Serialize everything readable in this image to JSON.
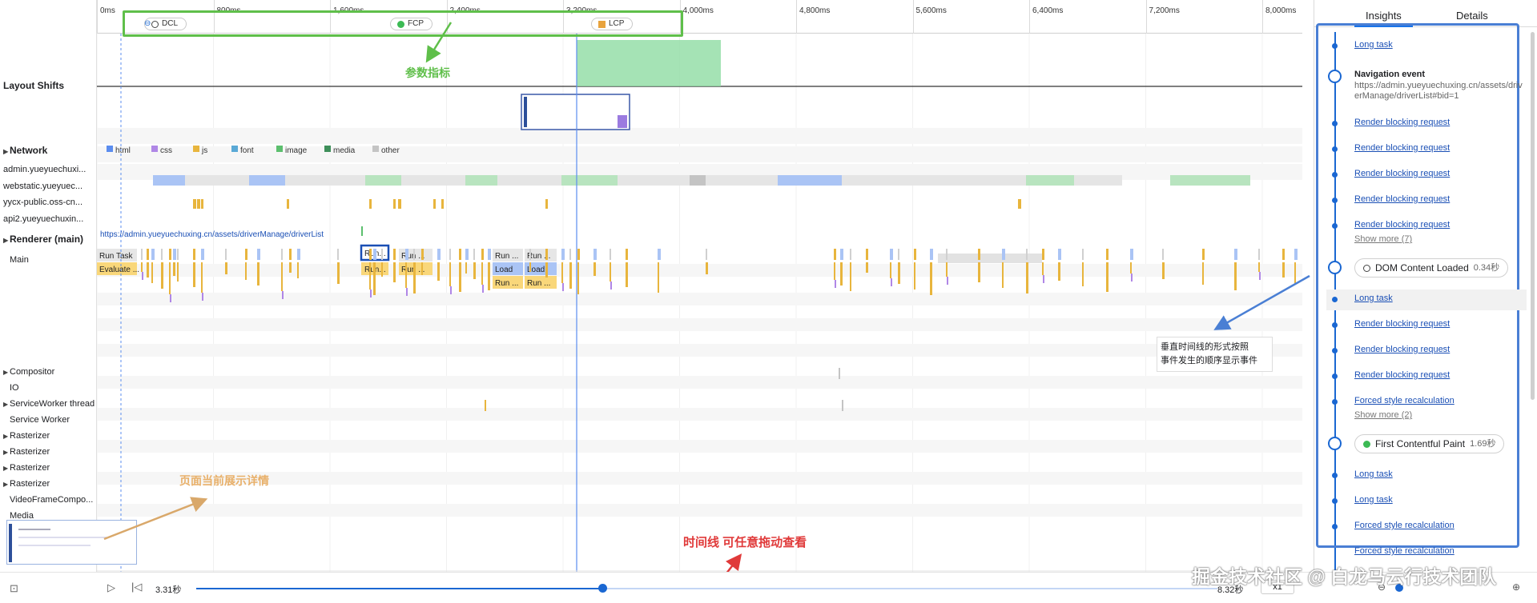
{
  "ruler": {
    "ticks": [
      "0ms",
      "800ms",
      "1,600ms",
      "2,400ms",
      "3,200ms",
      "4,000ms",
      "4,800ms",
      "5,600ms",
      "6,400ms",
      "7,200ms",
      "8,000ms"
    ]
  },
  "markers": {
    "dcl": {
      "label": "DCL",
      "color": "#ffffff"
    },
    "fcp": {
      "label": "FCP",
      "color": "#3cba54"
    },
    "lcp": {
      "label": "LCP",
      "color": "#e8a33d"
    }
  },
  "tracks": {
    "layout_shifts": "Layout Shifts",
    "network": "Network",
    "network_rows": [
      "admin.yueyuechuxi...",
      "webstatic.yueyuec...",
      "yycx-public.oss-cn...",
      "api2.yueyuechuxin..."
    ],
    "renderer": "Renderer (main)",
    "renderer_url": "https://admin.yueyuechuxing.cn/assets/driverManage/driverList",
    "main": "Main",
    "compositor": "Compositor",
    "io": "IO",
    "serviceworker_thread": "ServiceWorker thread",
    "service_worker": "Service Worker",
    "rasterizers": [
      "Rasterizer",
      "Rasterizer",
      "Rasterizer",
      "Rasterizer"
    ],
    "video_frame": "VideoFrameCompo...",
    "media": "Media"
  },
  "legend": [
    {
      "label": "html",
      "color": "#5b8def"
    },
    {
      "label": "css",
      "color": "#b087e6"
    },
    {
      "label": "js",
      "color": "#e8b53d"
    },
    {
      "label": "font",
      "color": "#5aa9d6"
    },
    {
      "label": "image",
      "color": "#5cbf6e"
    },
    {
      "label": "media",
      "color": "#3e8f5a"
    },
    {
      "label": "other",
      "color": "#c4c4c4"
    }
  ],
  "main_tasks": {
    "run_task": "Run Task",
    "evaluate": "Evaluate ...",
    "run_sel": "Run...",
    "run_sel2": "Run...",
    "run_a": "Run ...",
    "run_b": "Run ...",
    "run_c": "Run ...",
    "run_d": "Run ...",
    "run_e": "Run ...",
    "load_a": "Load",
    "load_b": "Load",
    "run_f": "Run ...",
    "run_g": "Run ..."
  },
  "panel": {
    "tab_insights": "Insights",
    "tab_details": "Details",
    "events": {
      "long_task_1": "Long task",
      "nav_title": "Navigation event",
      "nav_url": "https://admin.yueyuechuxing.cn/assets/driverManage/driverList#bid=1",
      "rbr_1": "Render blocking request",
      "rbr_2": "Render blocking request",
      "rbr_3": "Render blocking request",
      "rbr_4": "Render blocking request",
      "rbr_5": "Render blocking request",
      "show_more_1": "Show more (7)",
      "dcl_label": "DOM Content Loaded",
      "dcl_time": "0.34秒",
      "long_task_2": "Long task",
      "rbr_6": "Render blocking request",
      "rbr_7": "Render blocking request",
      "rbr_8": "Render blocking request",
      "fsr_1": "Forced style recalculation",
      "show_more_2": "Show more (2)",
      "fcp_label": "First Contentful Paint",
      "fcp_time": "1.69秒",
      "long_task_3": "Long task",
      "long_task_4": "Long task",
      "fsr_2": "Forced style recalculation",
      "fsr_3": "Forced style recalculation"
    }
  },
  "bottom": {
    "current_time": "3.31秒",
    "total_time": "8.32秒",
    "speed": "x1",
    "progress": 0.398
  },
  "annotations": {
    "metrics": "参数指标",
    "vertical_timeline_1": "垂直时间线的形式按照",
    "vertical_timeline_2": "事件发生的顺序显示事件",
    "page_detail": "页面当前展示详情",
    "timeline_drag": "时间线 可任意拖动查看",
    "watermark": "掘金技术社区 @ 白龙马云行技术团队"
  }
}
